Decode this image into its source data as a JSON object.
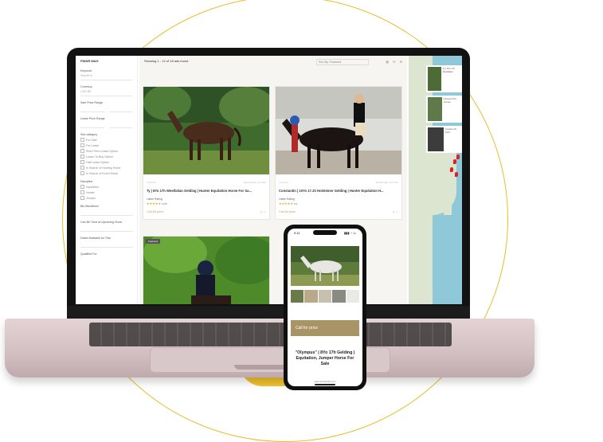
{
  "colors": {
    "accent": "#e9bd2e",
    "brand": "#a99466",
    "price": "#b9a35a",
    "pin": "#e02020"
  },
  "sidebar": {
    "header": "FINDR MAG",
    "keyword_label": "Keyword",
    "keyword_placeholder": "Search in",
    "currency_label": "Currency",
    "currency_value": "USD $$",
    "sale_price_label": "Sale Price Range",
    "lease_price_label": "Lease Price Range",
    "sub_category_label": "Sub category",
    "sub_category_options": [
      "For Sale",
      "For Lease",
      "Short Term Lease Option",
      "Lease-To-Buy Option",
      "Half Lease Option",
      "In Search of Hunting Horse",
      "In Search of Event Horse"
    ],
    "discipline_label": "Discipline",
    "discipline_options": [
      "Equitation",
      "Hunter",
      "Jumper"
    ],
    "bio_label": "Bio Bloodlines",
    "trial_label": "Can Be Tried at Upcoming Show",
    "dates_label": "Dates Available for Trial",
    "qualified_label": "Qualified For"
  },
  "toolbar": {
    "results_text": "Showing 1 - 12 of 18 ads found",
    "sort_label": "Sort By: Featured",
    "view_icons": [
      "grid-icon",
      "list-icon",
      "map-icon"
    ]
  },
  "listings": [
    {
      "date_left": "12 Hours",
      "date_right": "Wednesday, Oct 11th",
      "title": "Ty | 8Yo 17h Westfalian Gelding | Hunter Equitation Horse For Sa...",
      "rating_label": "Listee Rating",
      "stars": "★★★★★",
      "rating_value": "5.0/5",
      "price": "Call for price"
    },
    {
      "date_left": "12 Hours",
      "date_right": "Wednesday, Oct 11th",
      "title": "Constantin | 10Yo 17.1h Holsteiner Gelding | Hunter Equitation H...",
      "rating_label": "Listee Rating",
      "stars": "★★★★★",
      "rating_value": "5.0",
      "price": "Call for price"
    },
    {
      "badge": "Featured"
    }
  ],
  "map": {
    "items": [
      {
        "text": "Ty | 8Yo 17h Westfalian"
      },
      {
        "text": "Olympus 8Yo Jumper"
      },
      {
        "text": "Consta ntin 10Yo"
      }
    ]
  },
  "phone": {
    "time": "9:41",
    "signal": "▮▮▮ ◔ ▭",
    "call_button": "Call for price",
    "title": "\"Olympus\" | 8Yo 17h Gelding | Equitation, Jumper Horse For Sale",
    "url": "www.horsefindr.com"
  }
}
